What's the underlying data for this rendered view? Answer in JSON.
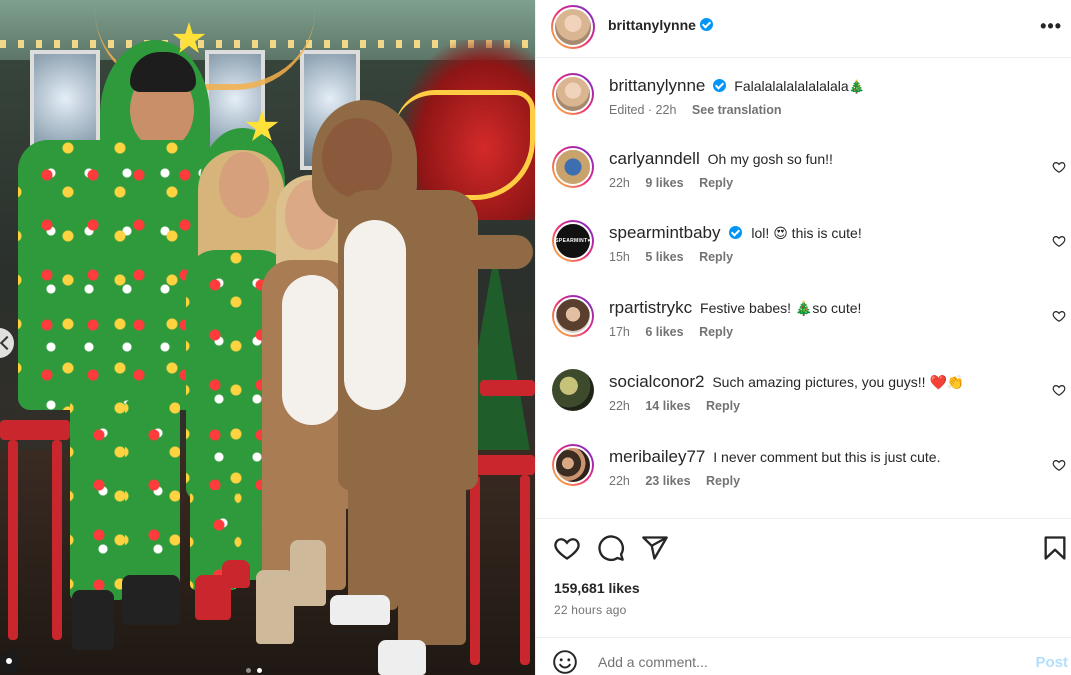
{
  "post": {
    "author": "brittanylynne",
    "verified": true,
    "more_icon": "more-horizontal-icon"
  },
  "caption": {
    "username": "brittanylynne",
    "text": "Falalalalalalalalala",
    "emoji": "🎄",
    "edited": "Edited · 22h",
    "see_translation": "See translation"
  },
  "comments": [
    {
      "username": "carlyanndell",
      "verified": false,
      "text": "Oh my gosh so fun!!",
      "emoji": "",
      "time": "22h",
      "likes": "9 likes",
      "reply": "Reply"
    },
    {
      "username": "spearmintbaby",
      "verified": true,
      "text": "lol! 😍 this is cute!",
      "emoji": "",
      "time": "15h",
      "likes": "5 likes",
      "reply": "Reply"
    },
    {
      "username": "rpartistrykc",
      "verified": false,
      "text": "Festive babes! 🎄so cute!",
      "emoji": "",
      "time": "17h",
      "likes": "6 likes",
      "reply": "Reply"
    },
    {
      "username": "socialconor2",
      "verified": false,
      "text": "Such amazing pictures, you guys!! ❤️👏",
      "emoji": "",
      "time": "22h",
      "likes": "14 likes",
      "reply": "Reply"
    },
    {
      "username": "meribailey77",
      "verified": false,
      "text": "I never comment but this is just cute.",
      "emoji": "",
      "time": "22h",
      "likes": "23 likes",
      "reply": "Reply"
    }
  ],
  "stats": {
    "likes": "159,681 likes",
    "time_ago": "22 hours ago"
  },
  "composer": {
    "placeholder": "Add a comment...",
    "post_label": "Post"
  },
  "colors": {
    "accent": "#0095f6",
    "post_disabled": "#b2dffc",
    "muted": "#737373"
  }
}
